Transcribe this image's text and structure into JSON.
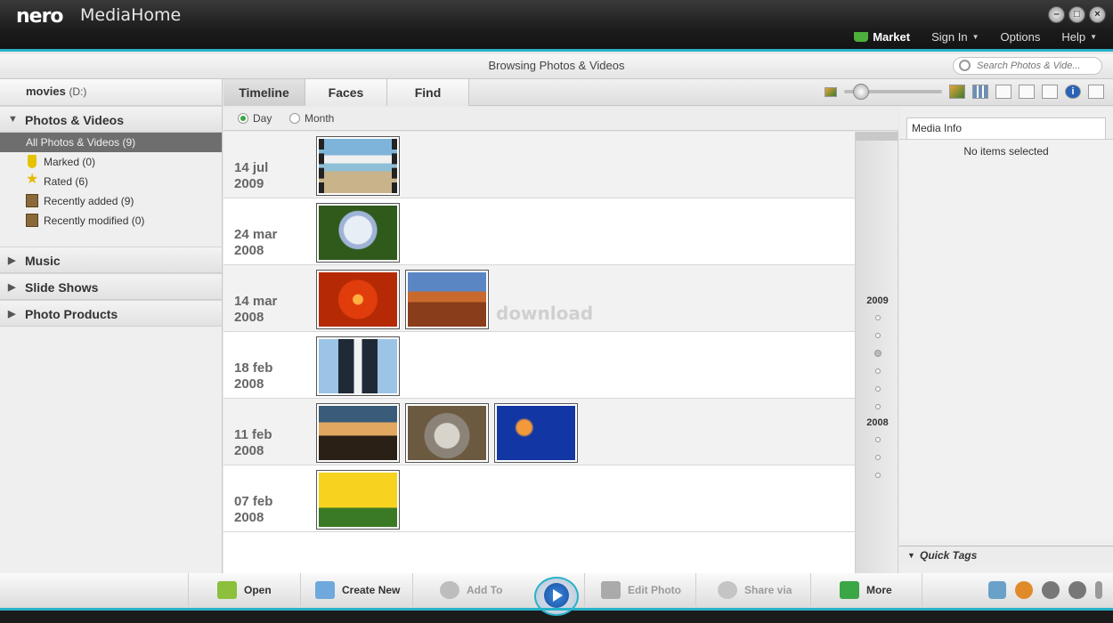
{
  "titlebar": {
    "logo": "nero",
    "app_name": "MediaHome",
    "menu": {
      "market": "Market",
      "sign_in": "Sign In",
      "options": "Options",
      "help": "Help"
    },
    "window_buttons": [
      "minimize-icon",
      "maximize-icon",
      "close-icon"
    ]
  },
  "browsebar": {
    "title": "Browsing Photos & Videos",
    "search_placeholder": "Search Photos & Vide..."
  },
  "sidebar": {
    "drive_label": "movies",
    "drive_letter": "(D:)",
    "sections": {
      "photos": "Photos & Videos",
      "music": "Music",
      "slides": "Slide Shows",
      "products": "Photo Products"
    },
    "items": [
      {
        "label": "All Photos & Videos (9)",
        "icon": ""
      },
      {
        "label": "Marked (0)",
        "icon": "marker-icon"
      },
      {
        "label": "Rated (6)",
        "icon": "star-icon"
      },
      {
        "label": "Recently added (9)",
        "icon": "clock-box-icon"
      },
      {
        "label": "Recently modified (0)",
        "icon": "clock-box-icon"
      }
    ]
  },
  "tabs": [
    "Timeline",
    "Faces",
    "Find"
  ],
  "view": {
    "day": "Day",
    "month": "Month",
    "selected": "Day"
  },
  "timeline": {
    "rows": [
      {
        "day": "14 jul",
        "year": "2009",
        "thumbs": [
          "beach-video"
        ]
      },
      {
        "day": "24 mar",
        "year": "2008",
        "thumbs": [
          "hydrangea"
        ]
      },
      {
        "day": "14 mar",
        "year": "2008",
        "thumbs": [
          "chrysanthemum",
          "desert"
        ]
      },
      {
        "day": "18 feb",
        "year": "2008",
        "thumbs": [
          "penguins"
        ]
      },
      {
        "day": "11 feb",
        "year": "2008",
        "thumbs": [
          "lighthouse",
          "koala",
          "jellyfish"
        ]
      },
      {
        "day": "07 feb",
        "year": "2008",
        "thumbs": [
          "tulips"
        ]
      }
    ],
    "watermark": "download"
  },
  "years": {
    "y2009": "2009",
    "y2008": "2008"
  },
  "rightpanel": {
    "tab_label": "Media Info",
    "empty_text": "No items selected",
    "quick_tags": "Quick Tags"
  },
  "bottombar": {
    "open": "Open",
    "create_new": "Create New",
    "add_to": "Add To",
    "edit_photo": "Edit Photo",
    "share_via": "Share via",
    "more": "More"
  }
}
